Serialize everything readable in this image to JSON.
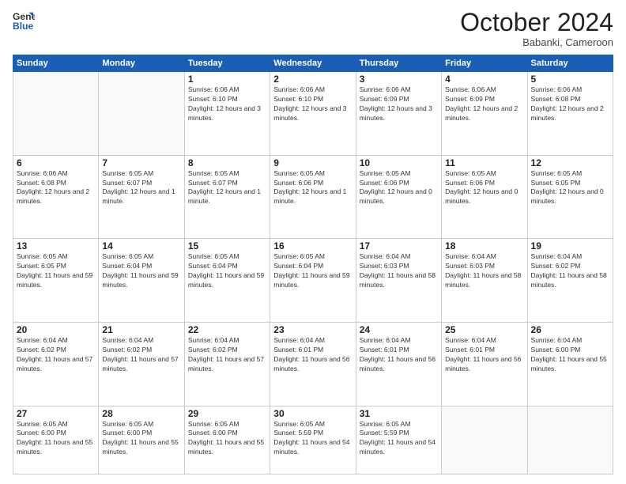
{
  "logo": {
    "line1": "General",
    "line2": "Blue"
  },
  "header": {
    "month": "October 2024",
    "location": "Babanki, Cameroon"
  },
  "weekdays": [
    "Sunday",
    "Monday",
    "Tuesday",
    "Wednesday",
    "Thursday",
    "Friday",
    "Saturday"
  ],
  "weeks": [
    [
      {
        "day": null
      },
      {
        "day": null
      },
      {
        "day": 1,
        "sunrise": "6:06 AM",
        "sunset": "6:10 PM",
        "daylight": "12 hours and 3 minutes."
      },
      {
        "day": 2,
        "sunrise": "6:06 AM",
        "sunset": "6:10 PM",
        "daylight": "12 hours and 3 minutes."
      },
      {
        "day": 3,
        "sunrise": "6:06 AM",
        "sunset": "6:09 PM",
        "daylight": "12 hours and 3 minutes."
      },
      {
        "day": 4,
        "sunrise": "6:06 AM",
        "sunset": "6:09 PM",
        "daylight": "12 hours and 2 minutes."
      },
      {
        "day": 5,
        "sunrise": "6:06 AM",
        "sunset": "6:08 PM",
        "daylight": "12 hours and 2 minutes."
      }
    ],
    [
      {
        "day": 6,
        "sunrise": "6:06 AM",
        "sunset": "6:08 PM",
        "daylight": "12 hours and 2 minutes."
      },
      {
        "day": 7,
        "sunrise": "6:05 AM",
        "sunset": "6:07 PM",
        "daylight": "12 hours and 1 minute."
      },
      {
        "day": 8,
        "sunrise": "6:05 AM",
        "sunset": "6:07 PM",
        "daylight": "12 hours and 1 minute."
      },
      {
        "day": 9,
        "sunrise": "6:05 AM",
        "sunset": "6:06 PM",
        "daylight": "12 hours and 1 minute."
      },
      {
        "day": 10,
        "sunrise": "6:05 AM",
        "sunset": "6:06 PM",
        "daylight": "12 hours and 0 minutes."
      },
      {
        "day": 11,
        "sunrise": "6:05 AM",
        "sunset": "6:06 PM",
        "daylight": "12 hours and 0 minutes."
      },
      {
        "day": 12,
        "sunrise": "6:05 AM",
        "sunset": "6:05 PM",
        "daylight": "12 hours and 0 minutes."
      }
    ],
    [
      {
        "day": 13,
        "sunrise": "6:05 AM",
        "sunset": "6:05 PM",
        "daylight": "11 hours and 59 minutes."
      },
      {
        "day": 14,
        "sunrise": "6:05 AM",
        "sunset": "6:04 PM",
        "daylight": "11 hours and 59 minutes."
      },
      {
        "day": 15,
        "sunrise": "6:05 AM",
        "sunset": "6:04 PM",
        "daylight": "11 hours and 59 minutes."
      },
      {
        "day": 16,
        "sunrise": "6:05 AM",
        "sunset": "6:04 PM",
        "daylight": "11 hours and 59 minutes."
      },
      {
        "day": 17,
        "sunrise": "6:04 AM",
        "sunset": "6:03 PM",
        "daylight": "11 hours and 58 minutes."
      },
      {
        "day": 18,
        "sunrise": "6:04 AM",
        "sunset": "6:03 PM",
        "daylight": "11 hours and 58 minutes."
      },
      {
        "day": 19,
        "sunrise": "6:04 AM",
        "sunset": "6:02 PM",
        "daylight": "11 hours and 58 minutes."
      }
    ],
    [
      {
        "day": 20,
        "sunrise": "6:04 AM",
        "sunset": "6:02 PM",
        "daylight": "11 hours and 57 minutes."
      },
      {
        "day": 21,
        "sunrise": "6:04 AM",
        "sunset": "6:02 PM",
        "daylight": "11 hours and 57 minutes."
      },
      {
        "day": 22,
        "sunrise": "6:04 AM",
        "sunset": "6:02 PM",
        "daylight": "11 hours and 57 minutes."
      },
      {
        "day": 23,
        "sunrise": "6:04 AM",
        "sunset": "6:01 PM",
        "daylight": "11 hours and 56 minutes."
      },
      {
        "day": 24,
        "sunrise": "6:04 AM",
        "sunset": "6:01 PM",
        "daylight": "11 hours and 56 minutes."
      },
      {
        "day": 25,
        "sunrise": "6:04 AM",
        "sunset": "6:01 PM",
        "daylight": "11 hours and 56 minutes."
      },
      {
        "day": 26,
        "sunrise": "6:04 AM",
        "sunset": "6:00 PM",
        "daylight": "11 hours and 55 minutes."
      }
    ],
    [
      {
        "day": 27,
        "sunrise": "6:05 AM",
        "sunset": "6:00 PM",
        "daylight": "11 hours and 55 minutes."
      },
      {
        "day": 28,
        "sunrise": "6:05 AM",
        "sunset": "6:00 PM",
        "daylight": "11 hours and 55 minutes."
      },
      {
        "day": 29,
        "sunrise": "6:05 AM",
        "sunset": "6:00 PM",
        "daylight": "11 hours and 55 minutes."
      },
      {
        "day": 30,
        "sunrise": "6:05 AM",
        "sunset": "5:59 PM",
        "daylight": "11 hours and 54 minutes."
      },
      {
        "day": 31,
        "sunrise": "6:05 AM",
        "sunset": "5:59 PM",
        "daylight": "11 hours and 54 minutes."
      },
      {
        "day": null
      },
      {
        "day": null
      }
    ]
  ]
}
